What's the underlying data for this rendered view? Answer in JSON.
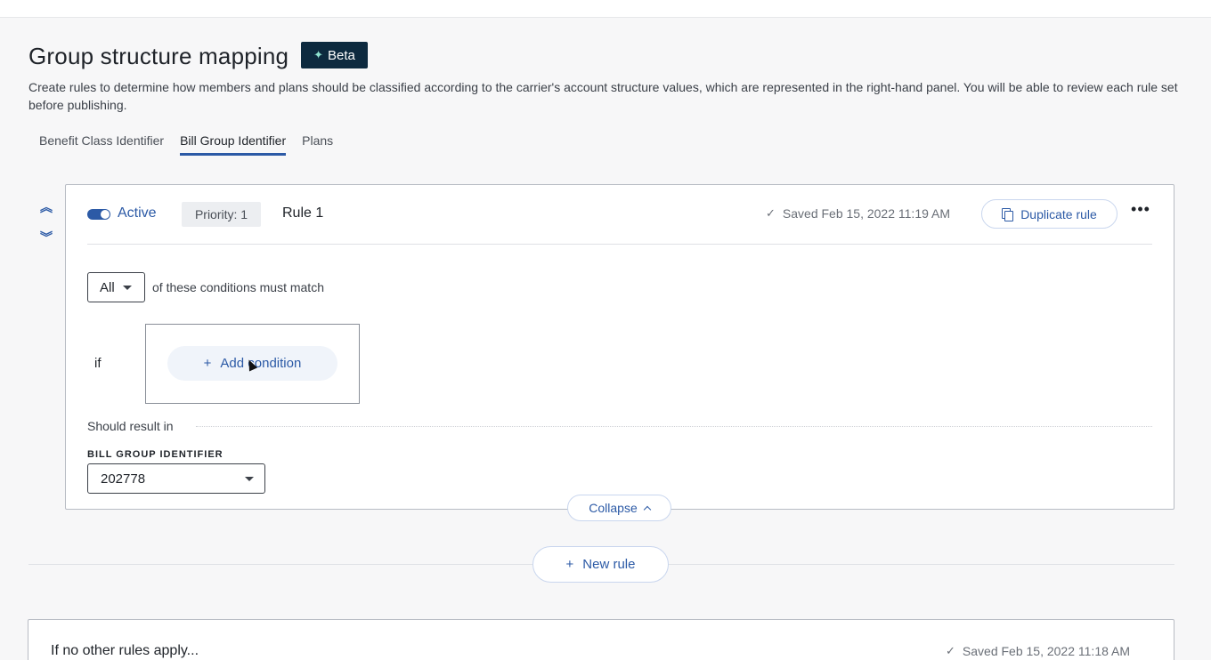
{
  "header": {
    "title": "Group structure mapping",
    "beta_label": "Beta",
    "description": "Create rules to determine how members and plans should be classified according to the carrier's account structure values, which are represented in the right-hand panel. You will be able to review each rule set before publishing."
  },
  "tabs": [
    {
      "label": "Benefit Class Identifier",
      "active": false
    },
    {
      "label": "Bill Group Identifier",
      "active": true
    },
    {
      "label": "Plans",
      "active": false
    }
  ],
  "rule": {
    "status_label": "Active",
    "priority_label": "Priority: 1",
    "name": "Rule 1",
    "saved_text": "Saved Feb 15, 2022 11:19 AM",
    "duplicate_label": "Duplicate rule",
    "match_value": "All",
    "match_text": "of these conditions must match",
    "if_label": "if",
    "add_condition_label": "Add condition",
    "result_label": "Should result in",
    "field_label": "BILL GROUP IDENTIFIER",
    "field_value": "202778",
    "collapse_label": "Collapse"
  },
  "new_rule_label": "New rule",
  "fallback": {
    "title": "If no other rules apply...",
    "saved_text": "Saved Feb 15, 2022 11:18 AM"
  },
  "colors": {
    "accent": "#2c5aa6",
    "badge_bg": "#0d2a3f"
  }
}
